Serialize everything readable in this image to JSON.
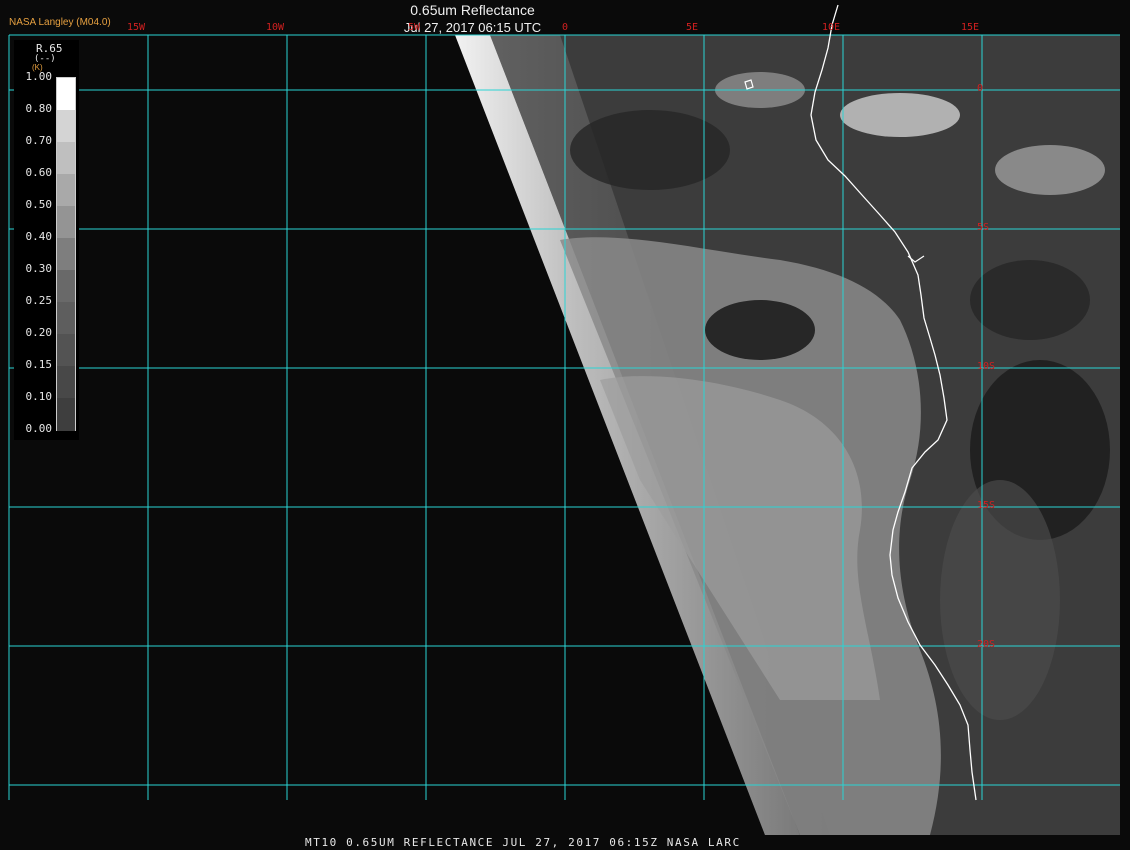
{
  "header": {
    "brand": "NASA Langley (M04.0)",
    "title": "0.65um Reflectance",
    "subtitle": "Jul 27, 2017 06:15 UTC"
  },
  "footer": {
    "text": "MT10  0.65UM REFLECTANCE   JUL 27, 2017 06:15Z   NASA LARC"
  },
  "legend": {
    "variable": "R.65",
    "unit": "(--)",
    "unit_prefix": "(K)",
    "ticks": [
      "1.00",
      "0.80",
      "0.70",
      "0.60",
      "0.50",
      "0.40",
      "0.30",
      "0.25",
      "0.20",
      "0.15",
      "0.10",
      "0.00"
    ],
    "tick_values": [
      1.0,
      0.8,
      0.7,
      0.6,
      0.5,
      0.4,
      0.3,
      0.25,
      0.2,
      0.15,
      0.1,
      0.0
    ]
  },
  "map": {
    "lon_labels": [
      "15W",
      "10W",
      "5W",
      "0",
      "5E",
      "10E",
      "15E"
    ],
    "lat_labels": [
      "0",
      "5S",
      "10S",
      "15S",
      "20S"
    ],
    "lon_values": [
      -15,
      -10,
      -5,
      0,
      5,
      10,
      15
    ],
    "lat_values": [
      0,
      -5,
      -10,
      -15,
      -20
    ],
    "colors": {
      "grid": "#2ad4d4",
      "coastline": "#ffffff",
      "grid_label": "#d02020",
      "space": "#0a0a0a"
    }
  }
}
